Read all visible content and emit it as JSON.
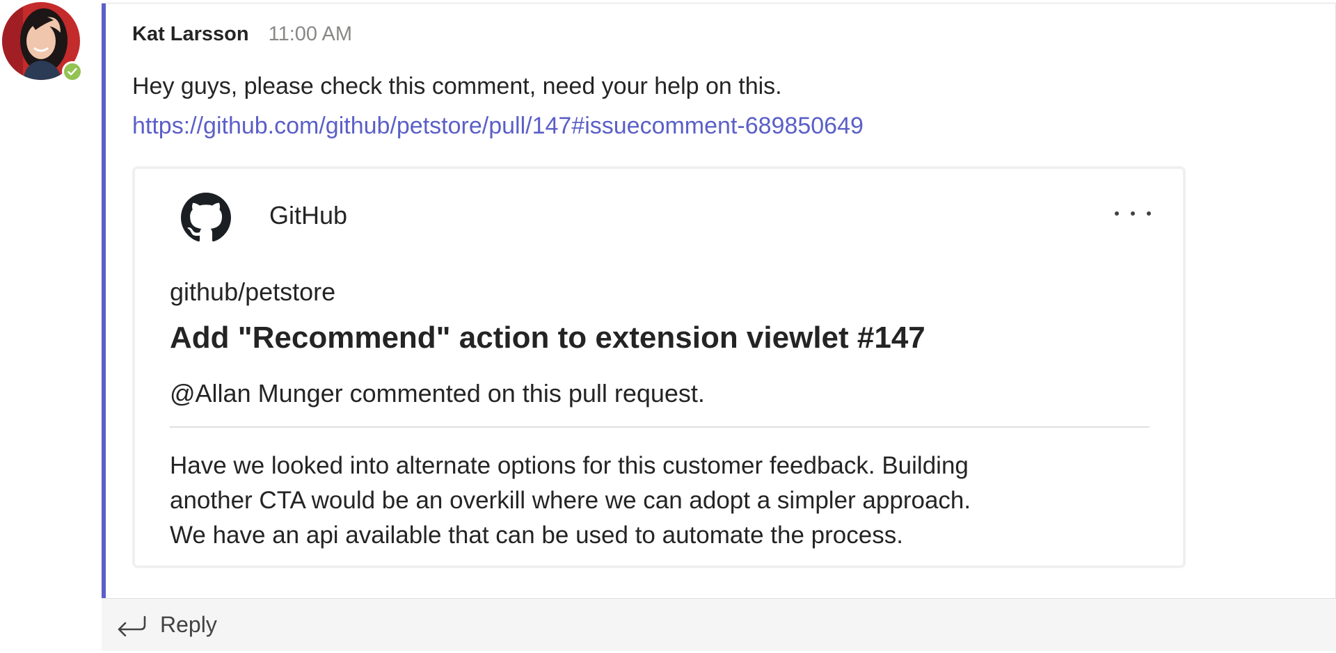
{
  "message": {
    "sender": "Kat Larsson",
    "time": "11:00 AM",
    "text": "Hey guys, please check this comment, need your help on this.",
    "link": "https://github.com/github/petstore/pull/147#issuecomment-689850649",
    "presence": "available",
    "accent_color": "#5b5fc7",
    "presence_color": "#92c353"
  },
  "card": {
    "app_name": "GitHub",
    "app_icon": "github-logo-icon",
    "more_icon": "more-options-icon",
    "repo": "github/petstore",
    "title": "Add \"Recommend\" action to extension viewlet #147",
    "subtitle": "@Allan Munger commented on this pull request.",
    "body_lines": [
      "Have we looked into alternate options for this customer feedback. Building",
      "another CTA would be an overkill where we can adopt a simpler approach.",
      "We have an api available that can be used to automate the process."
    ]
  },
  "reply": {
    "label": "Reply",
    "icon": "reply-arrow-icon"
  }
}
